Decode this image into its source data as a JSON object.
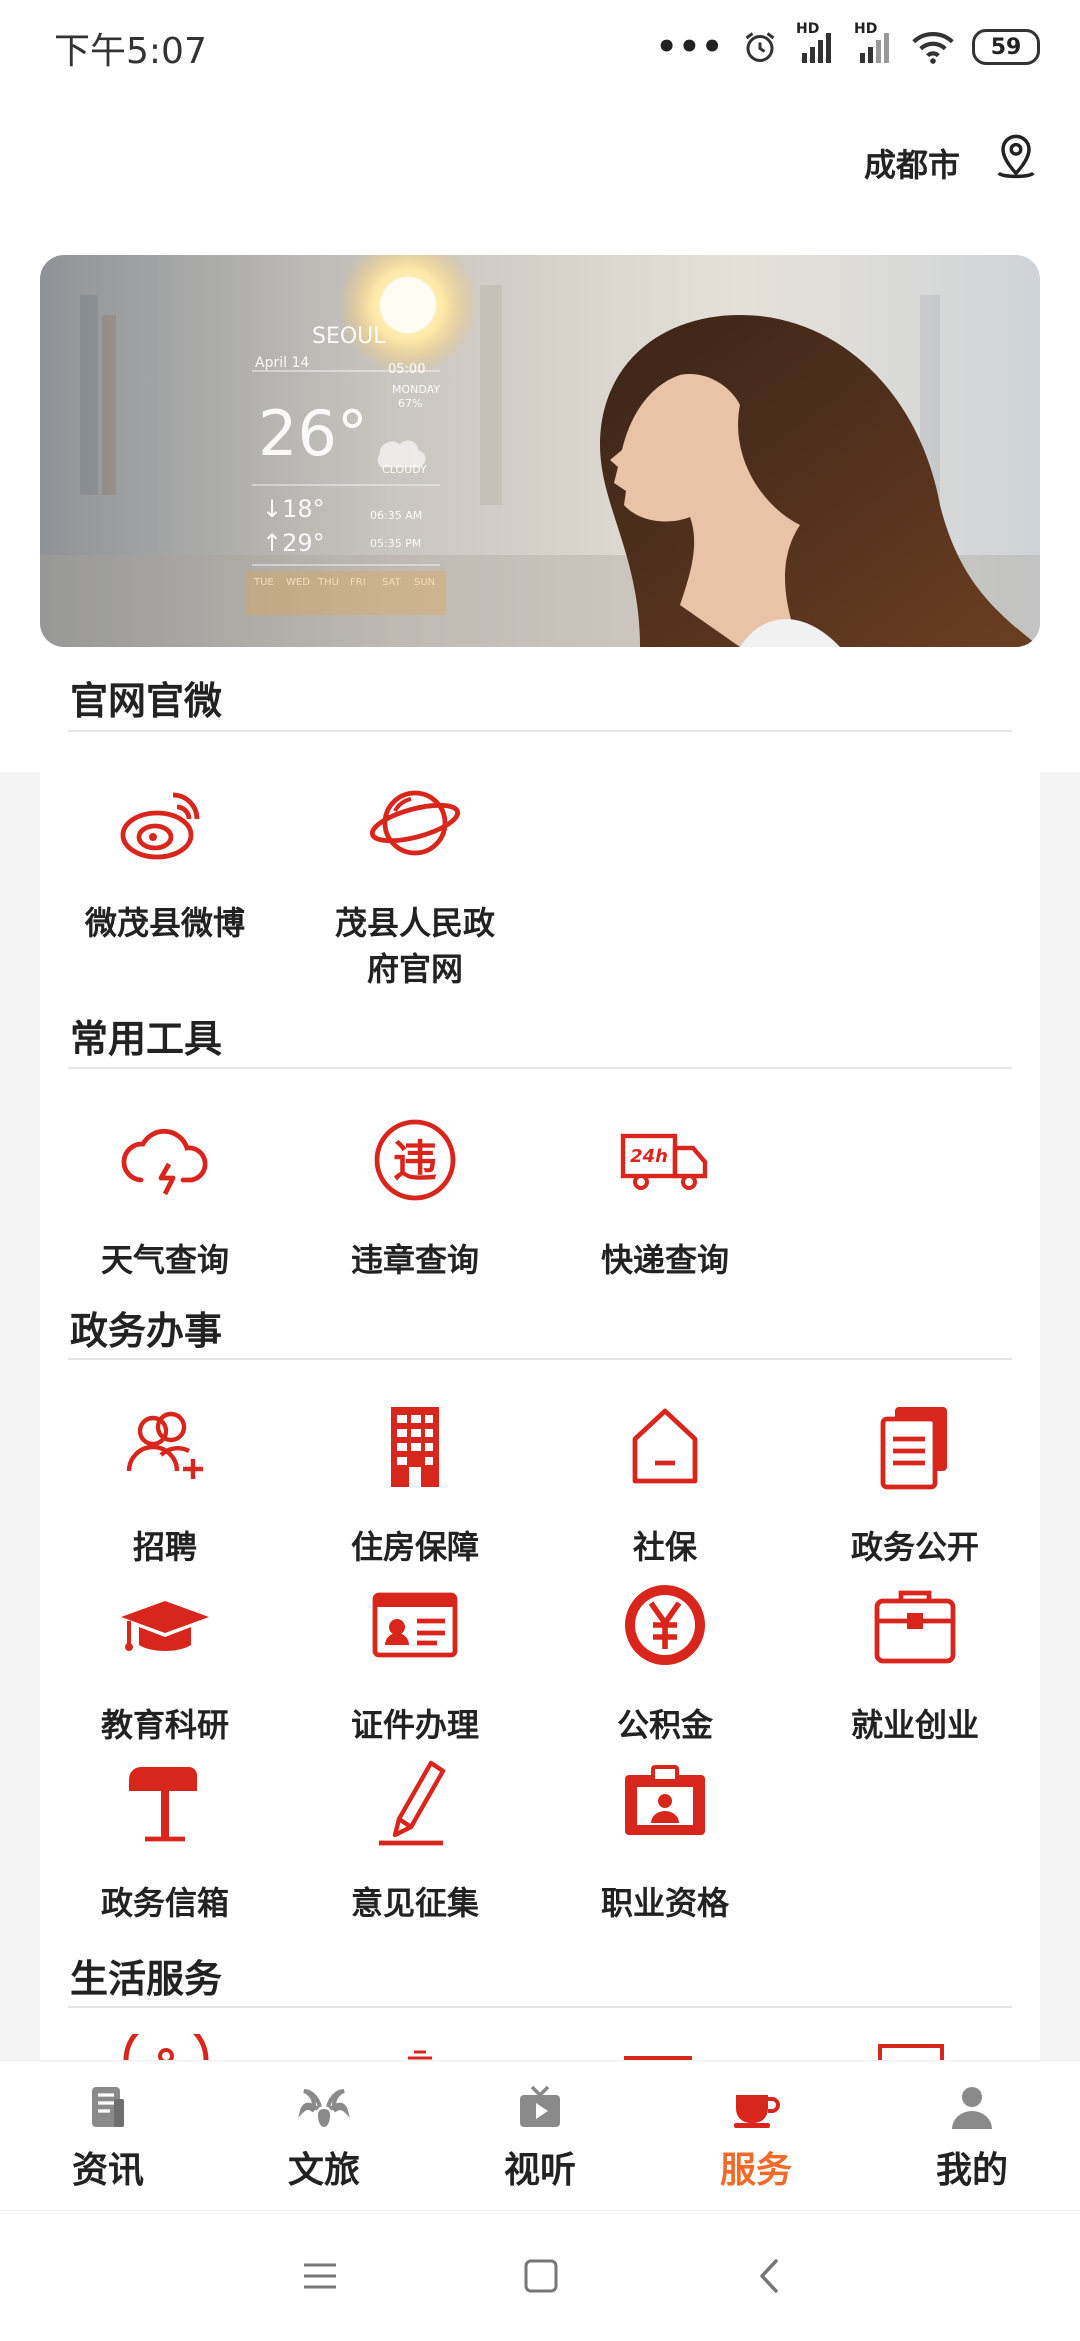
{
  "status_bar": {
    "time": "下午5:07",
    "battery": "59",
    "signal_label_1": "HD",
    "signal_label_2": "HD"
  },
  "header": {
    "city": "成都市"
  },
  "banner": {
    "city": "SEOUL",
    "date": "April 14",
    "time": "05:00",
    "day": "MONDAY",
    "humidity": "67%",
    "temp": "26°",
    "condition": "CLOUDY",
    "low": "18°",
    "high": "29°",
    "sunrise": "06:35 AM",
    "sunset": "05:35 PM",
    "days": [
      "TUE",
      "WED",
      "THU",
      "FRI",
      "SAT",
      "SUN"
    ]
  },
  "sections": [
    {
      "title": "官网官微",
      "items": [
        {
          "label": "微茂县微博",
          "icon": "weibo-icon"
        },
        {
          "label": "茂县人民政府官网",
          "icon": "planet-icon"
        }
      ]
    },
    {
      "title": "常用工具",
      "items": [
        {
          "label": "天气查询",
          "icon": "cloud-icon"
        },
        {
          "label": "违章查询",
          "icon": "violation-icon"
        },
        {
          "label": "快递查询",
          "icon": "delivery-truck-icon"
        }
      ]
    },
    {
      "title": "政务办事",
      "items": [
        {
          "label": "招聘",
          "icon": "add-user-icon"
        },
        {
          "label": "住房保障",
          "icon": "building-icon"
        },
        {
          "label": "社保",
          "icon": "house-icon"
        },
        {
          "label": "政务公开",
          "icon": "document-icon"
        },
        {
          "label": "教育科研",
          "icon": "graduation-cap-icon"
        },
        {
          "label": "证件办理",
          "icon": "id-card-icon"
        },
        {
          "label": "公积金",
          "icon": "yen-icon"
        },
        {
          "label": "就业创业",
          "icon": "briefcase-icon"
        },
        {
          "label": "政务信箱",
          "icon": "mailbox-icon"
        },
        {
          "label": "意见征集",
          "icon": "pen-icon"
        },
        {
          "label": "职业资格",
          "icon": "badge-icon"
        }
      ]
    },
    {
      "title": "生活服务",
      "items": []
    }
  ],
  "bottom_nav": [
    {
      "label": "资讯",
      "icon": "news-icon"
    },
    {
      "label": "文旅",
      "icon": "goat-icon"
    },
    {
      "label": "视听",
      "icon": "tv-icon"
    },
    {
      "label": "服务",
      "icon": "coffee-cup-icon",
      "active": true
    },
    {
      "label": "我的",
      "icon": "user-icon"
    }
  ],
  "colors": {
    "accent": "#d9261c",
    "nav_active": "#f06a2a"
  }
}
